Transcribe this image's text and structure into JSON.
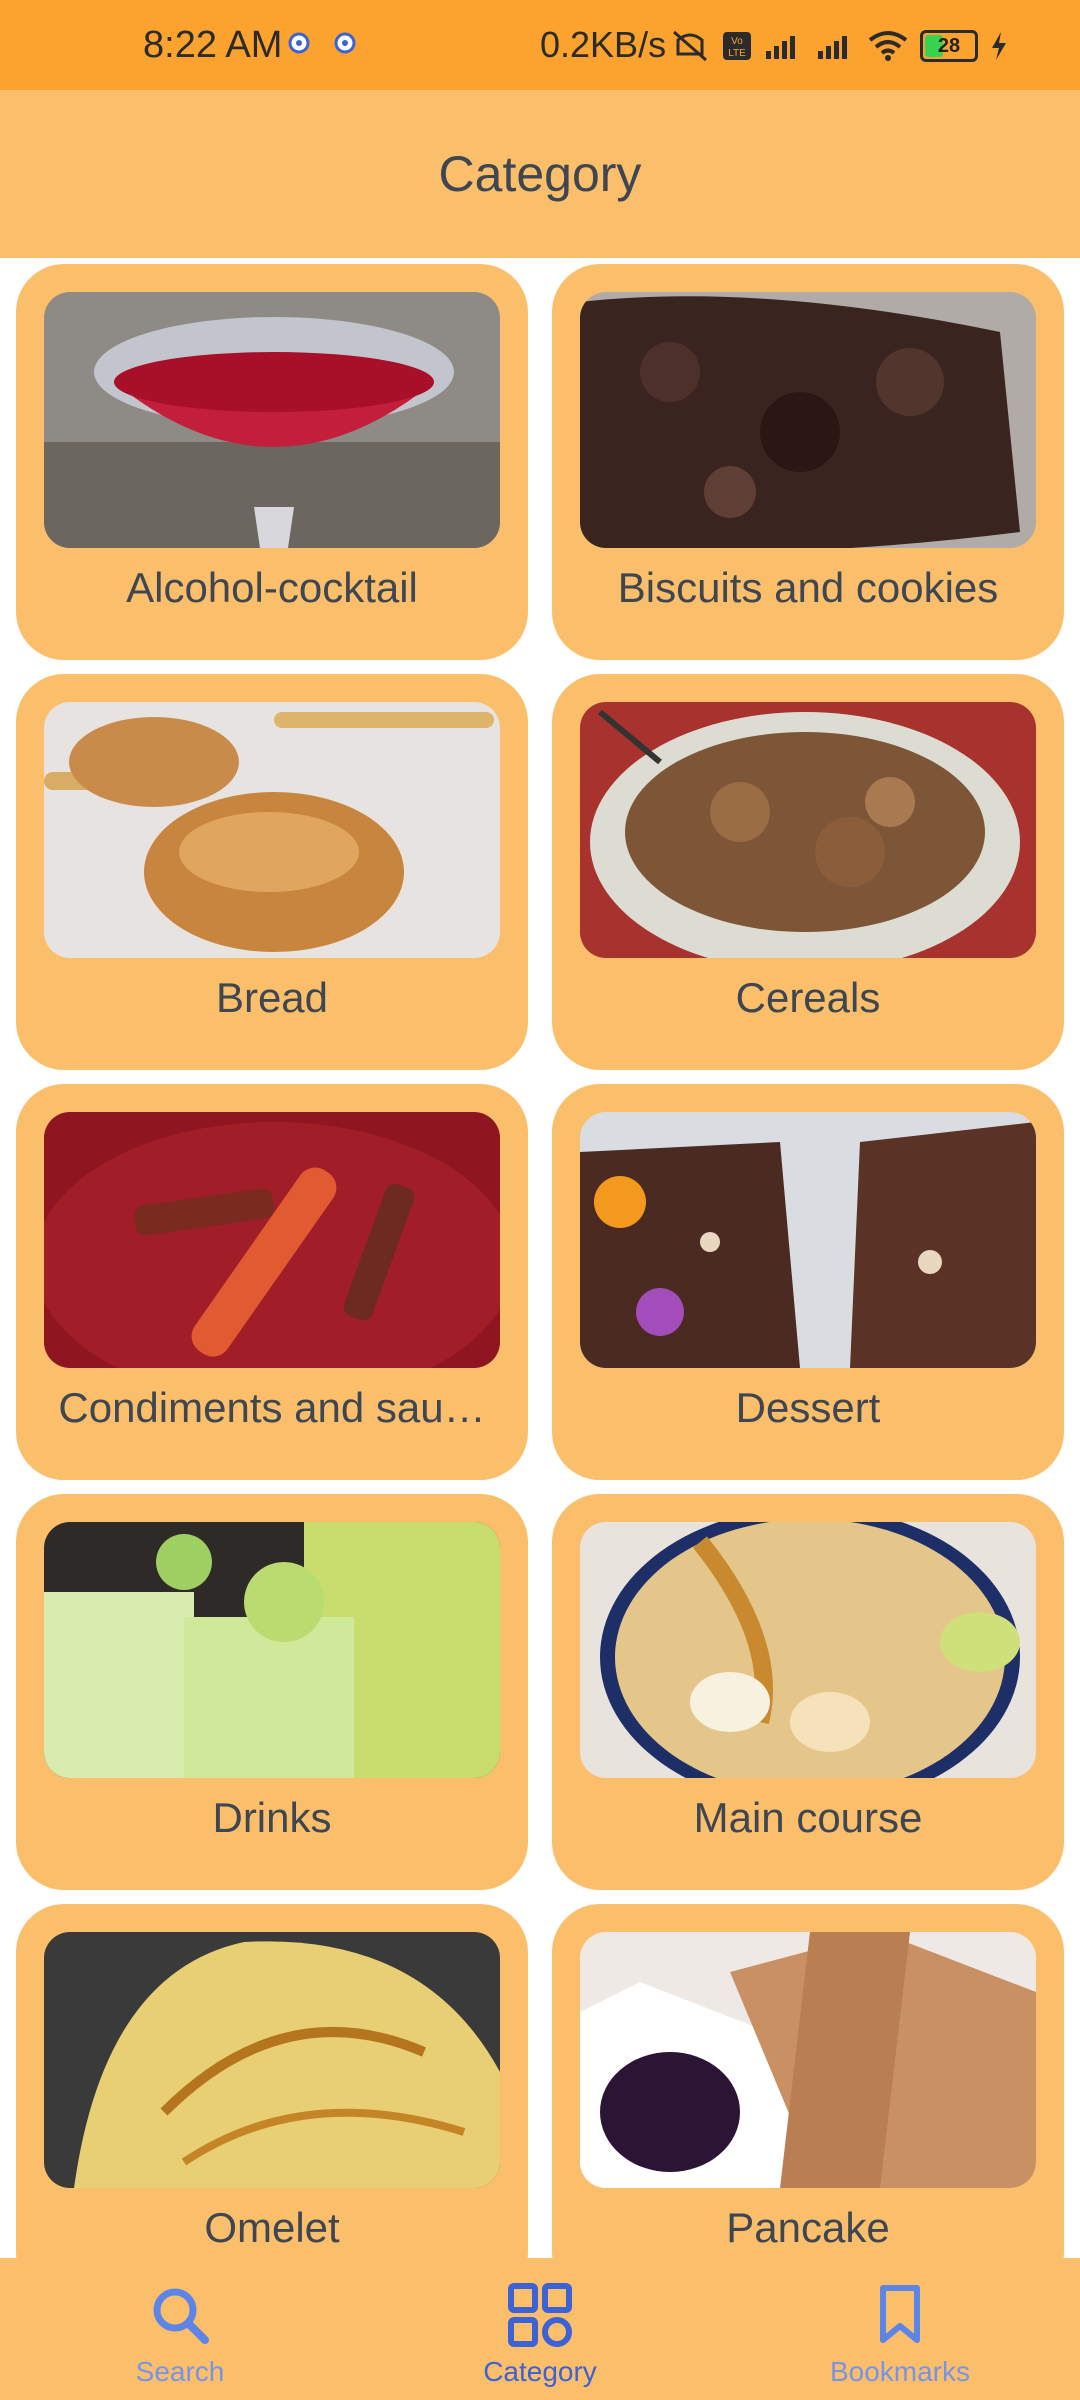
{
  "status_bar": {
    "time": "8:22 AM",
    "net_speed": "0.2KB/s",
    "battery": "28",
    "icons": [
      "settings-gear-icon",
      "settings-gear-icon",
      "mute-icon",
      "volte-icon",
      "signal-icon",
      "signal-icon",
      "wifi-icon",
      "battery-icon",
      "charging-icon"
    ]
  },
  "app_bar": {
    "title": "Category"
  },
  "categories": [
    {
      "label": "Alcohol-cocktail"
    },
    {
      "label": "Biscuits and cookies"
    },
    {
      "label": "Bread"
    },
    {
      "label": "Cereals"
    },
    {
      "label": "Condiments and sau…"
    },
    {
      "label": "Dessert"
    },
    {
      "label": "Drinks"
    },
    {
      "label": "Main course"
    },
    {
      "label": "Omelet"
    },
    {
      "label": "Pancake"
    }
  ],
  "bottom_nav": {
    "items": [
      {
        "label": "Search",
        "icon": "search-icon",
        "active": false
      },
      {
        "label": "Category",
        "icon": "grid-icon",
        "active": true
      },
      {
        "label": "Bookmarks",
        "icon": "bookmark-icon",
        "active": false
      }
    ]
  },
  "colors": {
    "status_bar": "#fba22f",
    "card": "#fbbf6c",
    "accent": "#3c62d5"
  }
}
